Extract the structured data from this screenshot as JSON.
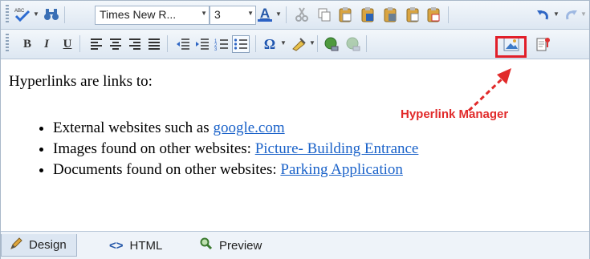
{
  "toolbar1": {
    "font_name": "Times New R...",
    "font_size": "3",
    "font_color_letter": "A"
  },
  "toolbar2": {
    "bold": "B",
    "italic": "I",
    "underline": "U",
    "symbol": "Ω"
  },
  "annotation": {
    "label": "Hyperlink Manager",
    "color": "#e12a2a"
  },
  "content": {
    "intro": "Hyperlinks are links to:",
    "items": [
      {
        "text": "External websites such as ",
        "link": "google.com"
      },
      {
        "text": "Images found on other websites: ",
        "link": "Picture- Building Entrance"
      },
      {
        "text": "Documents found on other websites: ",
        "link": "Parking Application"
      }
    ],
    "link_color": "#1a62c9"
  },
  "tabs": [
    {
      "label": "Design",
      "icon": "pencil-icon",
      "active": true
    },
    {
      "label": "HTML",
      "icon": "code-icon",
      "active": false
    },
    {
      "label": "Preview",
      "icon": "magnifier-icon",
      "active": false
    }
  ]
}
